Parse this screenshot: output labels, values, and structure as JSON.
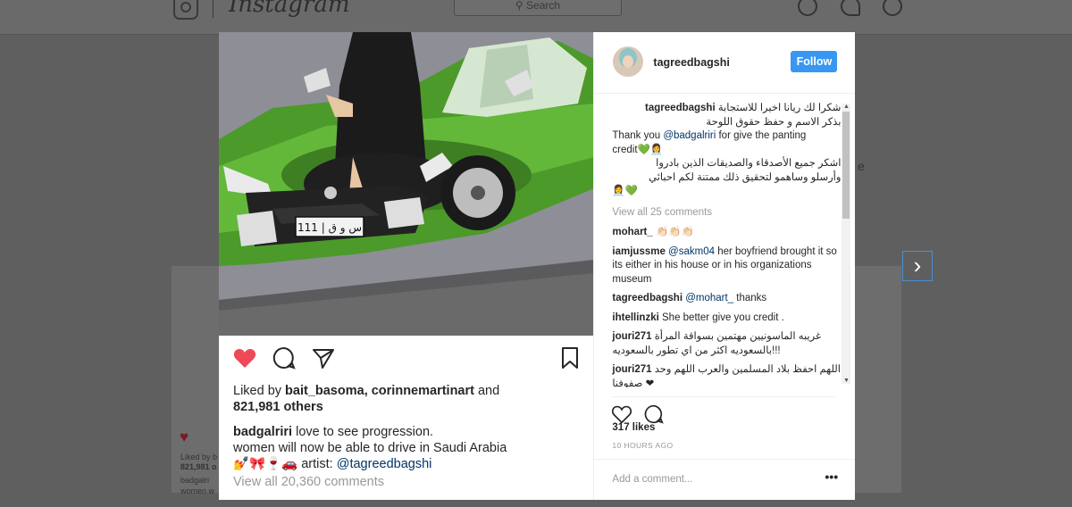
{
  "app": {
    "wordmark": "Instagram",
    "search_placeholder": "Search"
  },
  "colors": {
    "accent_blue": "#3897f0",
    "like_red": "#ed4956",
    "mention_blue": "#003569",
    "muted_gray": "#999999"
  },
  "background_page": {
    "card_likes_text": "Liked by b",
    "card_likes_count": "821,981 o",
    "card_caption_user": "badgalri",
    "card_caption_text": "women w",
    "side_letter": "e"
  },
  "post": {
    "liked_by_prefix": "Liked by ",
    "liked_by_users": "bait_basoma, corinnemartinart",
    "liked_by_and": " and",
    "liked_by_others": "821,981 others",
    "caption_user": "badgalriri",
    "caption_line1": " love to see progression.",
    "caption_line2": "women will now be able to drive in Saudi Arabia",
    "caption_emojis": "💅🎀🍷🚗",
    "caption_artist_label": " artist: ",
    "caption_artist_mention": "@tagreedbagshi",
    "view_all_comments": "View all 20,360 comments",
    "plate_text": "111 | س و ق"
  },
  "panel": {
    "username": "tagreedbagshi",
    "follow_label": "Follow",
    "main_comment": {
      "user": "tagreedbagshi",
      "line1": "شكرا لك ريانا اخيرا للاستجابة",
      "line2": "بذكر الاسم و حفظ حقوق اللوحة",
      "thanks_prefix": "Thank you ",
      "thanks_mention": "@badgalriri",
      "thanks_suffix": " for give the panting",
      "credit": "credit",
      "credit_glyphs": "💚👩‍💼",
      "line3": "اشكر جميع الأصدقاء والصديقات الذين بادروا",
      "line4": "وأرسلو وساهمو لتحقيق ذلك ممتنة لكم احبائي",
      "end_glyphs": "👩‍💼💚"
    },
    "view_all_label": "View all 25 comments",
    "comments": [
      {
        "user": "mohart_",
        "text": " 👏🏻👏🏻👏🏻"
      },
      {
        "user": "iamjussme",
        "mention": " @sakm04",
        "text": " her boyfriend brought it so its either in his house or in his organizations museum"
      },
      {
        "user": "tagreedbagshi",
        "mention": " @mohart_",
        "text": " thanks"
      },
      {
        "user": "ihtellinzki",
        "text": " She better give you credit ."
      },
      {
        "user": "jouri271",
        "text": "غريبه الماسونيين مهتمين بسواقة المرأة بالسعوديه اكثر من اي تطور بالسعوديه!!!"
      },
      {
        "user": "jouri271",
        "text": "اللهم احفظ بلاد المسلمين والعرب اللهم وحد صفوفنا ❤"
      }
    ],
    "likes": "317 likes",
    "timestamp": "10 HOURS AGO",
    "add_comment_placeholder": "Add a comment...",
    "more_label": "•••"
  }
}
